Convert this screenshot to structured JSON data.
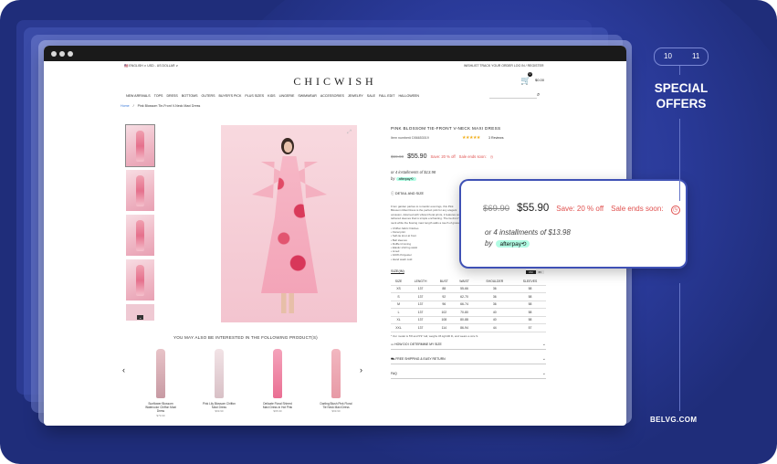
{
  "topbar": {
    "left": "🇺🇸 ENGLISH ∨   USD - US DOLLAR ∨",
    "right": "WISHLIST   TRACK YOUR ORDER   LOG IN / REGISTER"
  },
  "logo": "CHICWISH",
  "cart": {
    "count": "0",
    "total": "$0.00"
  },
  "nav": [
    "NEW ARRIVALS",
    "TOPS",
    "DRESS",
    "BOTTOMS",
    "OUTERS",
    "BUYER'S PICK",
    "PLUS SIZES",
    "KIDS",
    "LINGERIE",
    "SWIMWEAR",
    "ACCESSORIES",
    "JEWELRY",
    "SALE",
    "FALL EDIT",
    "HALLOWEEN"
  ],
  "breadcrumb": {
    "home": "Home",
    "sep": "/",
    "current": "Pink Blossom Tie-Front V-Neck Maxi Dress"
  },
  "product": {
    "title": "PINK BLOSSOM TIE-FRONT V-NECK MAXI DRESS",
    "item_number": "Item number# D56653019",
    "stars": "★★★★★",
    "reviews": "3 Reviews",
    "old_price": "$69.90",
    "new_price": "$55.90",
    "save": "Save: 20 % off",
    "sale_ends": "Sale ends soon:",
    "installments": "or 4 installments of $13.98",
    "by": "by",
    "afterpay": "afterpay⟲",
    "detail_heading": "DETAIL AND SIZE",
    "description": "From garden parties to romantic evenings, this Pink Blossom Maxi Dress is the perfect pick for any elegant occasion. Adorned with vibrant floral prints, it features softly tethered sleeves that is simple enchanting. The tie-front V-neck while the flowing maxi length adds a touch of grace.",
    "features": [
      "Chiffon fabric finishes",
      "Floral print",
      "Self-tie knot at front",
      "Bell sleeves",
      "Ruffle trimming",
      "Elastic shirring waist",
      "Lined",
      "100% Polyester",
      "Hand wash cold"
    ],
    "size_heading": "SIZE(IN)",
    "units": {
      "cm": "CM",
      "in": "IN"
    },
    "model_note": "* Our model is 5'8 and 5'9\" tall, weighs 45 kg/100 lb, and wears a size S.",
    "accordions": [
      "HOW DO I DETERMINE MY SIZE",
      "FREE SHIPPING & EASY RETURN",
      "FAQ"
    ]
  },
  "size_table": {
    "headers": [
      "SIZE",
      "LENGTH",
      "BUST",
      "WAIST",
      "SHOULDER",
      "SLEEVES"
    ],
    "rows": [
      [
        "XS",
        "137",
        "88",
        "55-66",
        "36",
        "58"
      ],
      [
        "S",
        "137",
        "92",
        "62-70",
        "36",
        "58"
      ],
      [
        "M",
        "137",
        "96",
        "66-74",
        "36",
        "58"
      ],
      [
        "L",
        "137",
        "102",
        "70-80",
        "40",
        "58"
      ],
      [
        "XL",
        "137",
        "108",
        "80-88",
        "40",
        "58"
      ],
      [
        "XXL",
        "137",
        "114",
        "86-94",
        "44",
        "57"
      ]
    ]
  },
  "recommend": {
    "title": "YOU MAY ALSO BE INTERESTED IN THE FOLLOWING PRODUCT(S)",
    "items": [
      {
        "name": "Sunflower Blossom Watercolor Chiffon Maxi Dress",
        "price": "$79.90"
      },
      {
        "name": "Pink Lily Blossom Chiffon Maxi Dress",
        "price": "$69.90"
      },
      {
        "name": "Delicate Floral Shirred Maxi Dress in Hot Pink",
        "price": "$65.90"
      },
      {
        "name": "Darling Blush Pink Floral Tie Neck Maxi Dress",
        "price": "$69.90"
      }
    ]
  },
  "popup": {
    "old_price": "$69.90",
    "new_price": "$55.90",
    "save": "Save: 20 % off",
    "sale_ends": "Sale ends soon:",
    "installments": "or 4 installments of $13.98",
    "by": "by",
    "afterpay": "afterpay⟲"
  },
  "side": {
    "page_a": "10",
    "page_b": "11",
    "headline_1": "SPECIAL",
    "headline_2": "OFFERS",
    "brand": "BELVG.COM"
  },
  "colors": {
    "frame": "#1f2d7a",
    "accent": "#3f51b5",
    "sale_red": "#e0514f",
    "afterpay": "#b2fce4"
  }
}
